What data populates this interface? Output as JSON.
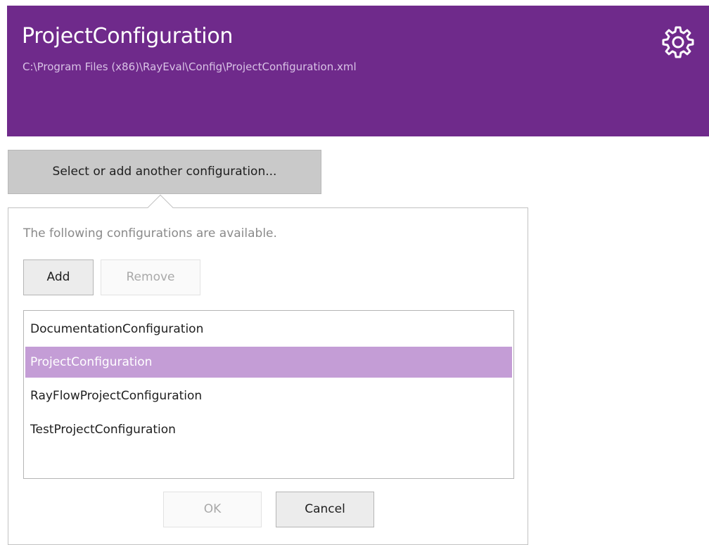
{
  "header": {
    "title": "ProjectConfiguration",
    "path": "C:\\Program Files (x86)\\RayEval\\Config\\ProjectConfiguration.xml",
    "settings_icon": "gear-icon",
    "background_color": "#6f2a8b"
  },
  "selector": {
    "button_label": "Select or add another configuration..."
  },
  "popup": {
    "description": "The following configurations are available.",
    "add_label": "Add",
    "remove_label": "Remove",
    "items": [
      {
        "label": "DocumentationConfiguration",
        "selected": false
      },
      {
        "label": "ProjectConfiguration",
        "selected": true
      },
      {
        "label": "RayFlowProjectConfiguration",
        "selected": false
      },
      {
        "label": "TestProjectConfiguration",
        "selected": false
      }
    ],
    "ok_label": "OK",
    "cancel_label": "Cancel",
    "selected_color": "#c49dd6"
  }
}
